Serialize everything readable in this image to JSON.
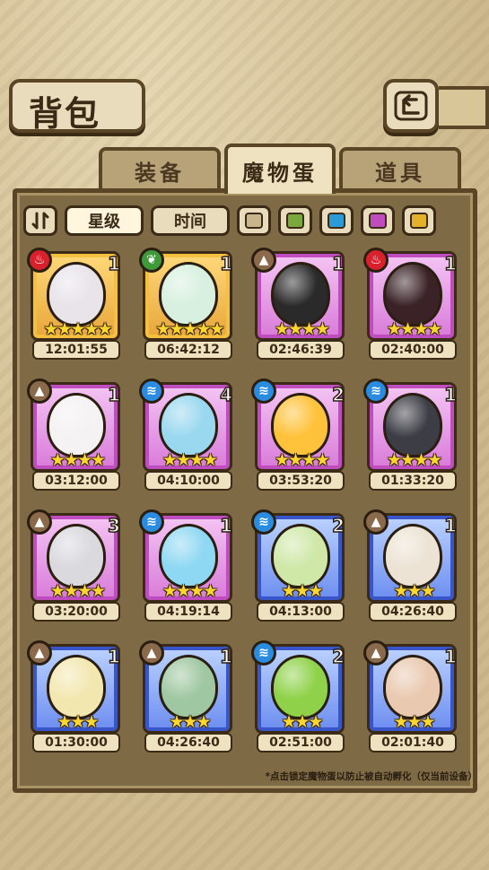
{
  "header": {
    "title": "背包"
  },
  "tabs": [
    {
      "label": "装备",
      "active": false
    },
    {
      "label": "魔物蛋",
      "active": true
    },
    {
      "label": "道具",
      "active": false
    }
  ],
  "toolbar": {
    "sort_icon": "sort-icon",
    "chips": [
      {
        "label": "星级",
        "active": true
      },
      {
        "label": "时间",
        "active": false
      }
    ],
    "swatches": [
      "#c9b58c",
      "#79a83b",
      "#2a9bd6",
      "#c04dc0",
      "#e3b12a"
    ]
  },
  "eggs": [
    {
      "element": "fire",
      "frame": "gold",
      "count": "1",
      "stars": 5,
      "time": "12:01:55",
      "egg_color": "#e8e4ea"
    },
    {
      "element": "leaf",
      "frame": "gold",
      "count": "1",
      "stars": 5,
      "time": "06:42:12",
      "egg_color": "#d7f0df"
    },
    {
      "element": "earth",
      "frame": "purple",
      "count": "1",
      "stars": 4,
      "time": "02:46:39",
      "egg_color": "#2a2a2a"
    },
    {
      "element": "fire",
      "frame": "purple",
      "count": "1",
      "stars": 4,
      "time": "02:40:00",
      "egg_color": "#3a2226"
    },
    {
      "element": "earth",
      "frame": "purple",
      "count": "1",
      "stars": 4,
      "time": "03:12:00",
      "egg_color": "#f4f2f2"
    },
    {
      "element": "water",
      "frame": "purple",
      "count": "4",
      "stars": 4,
      "time": "04:10:00",
      "egg_color": "#9ad8f0"
    },
    {
      "element": "water",
      "frame": "purple",
      "count": "2",
      "stars": 4,
      "time": "03:53:20",
      "egg_color": "#ffc23a"
    },
    {
      "element": "water",
      "frame": "purple",
      "count": "1",
      "stars": 4,
      "time": "01:33:20",
      "egg_color": "#3d3d46"
    },
    {
      "element": "earth",
      "frame": "purple",
      "count": "3",
      "stars": 4,
      "time": "03:20:00",
      "egg_color": "#d9d9de"
    },
    {
      "element": "water",
      "frame": "purple",
      "count": "1",
      "stars": 4,
      "time": "04:19:14",
      "egg_color": "#8fd8f3"
    },
    {
      "element": "water",
      "frame": "blue",
      "count": "2",
      "stars": 3,
      "time": "04:13:00",
      "egg_color": "#cfe8a8"
    },
    {
      "element": "earth",
      "frame": "blue",
      "count": "1",
      "stars": 3,
      "time": "04:26:40",
      "egg_color": "#ece3d4"
    },
    {
      "element": "earth",
      "frame": "blue",
      "count": "1",
      "stars": 3,
      "time": "01:30:00",
      "egg_color": "#f3e7b0"
    },
    {
      "element": "earth",
      "frame": "blue",
      "count": "1",
      "stars": 3,
      "time": "04:26:40",
      "egg_color": "#9fc7a1"
    },
    {
      "element": "water",
      "frame": "blue",
      "count": "2",
      "stars": 3,
      "time": "02:51:00",
      "egg_color": "#8fd24a"
    },
    {
      "element": "earth",
      "frame": "blue",
      "count": "1",
      "stars": 3,
      "time": "02:01:40",
      "egg_color": "#e9c9b0"
    }
  ],
  "footer_note": "*点击锁定魔物蛋以防止被自动孵化（仅当前设备）"
}
